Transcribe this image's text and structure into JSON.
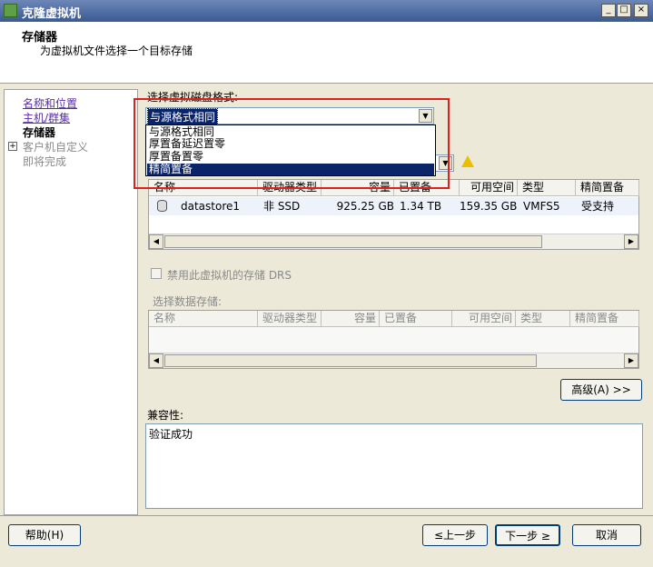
{
  "window": {
    "title": "克隆虚拟机",
    "min": "_",
    "max": "□",
    "close": "×"
  },
  "header": {
    "title": "存储器",
    "subtitle": "为虚拟机文件选择一个目标存储"
  },
  "nav": {
    "items": [
      {
        "label": "名称和位置"
      },
      {
        "label": "主机/群集"
      },
      {
        "label": "存储器"
      },
      {
        "label": "客户机自定义"
      },
      {
        "label": "即将完成"
      }
    ],
    "expander": "+"
  },
  "disk_format": {
    "label": "选择虚拟磁盘格式:",
    "selected": "与源格式相同",
    "options": [
      "与源格式相同",
      "厚置备延迟置零",
      "厚置备置零",
      "精简置备"
    ],
    "highlighted_index": 3
  },
  "storage_table": {
    "columns": [
      "名称",
      "驱动器类型",
      "容量",
      "已置备",
      "可用空间",
      "类型",
      "精简置备"
    ],
    "rows": [
      {
        "name": "datastore1",
        "drive": "非 SSD",
        "capacity": "925.25 GB",
        "provisioned": "1.34 TB",
        "free": "159.35 GB",
        "type": "VMFS5",
        "thin": "受支持"
      }
    ]
  },
  "drs": {
    "label": "禁用此虚拟机的存储 DRS"
  },
  "select_datastore": {
    "label": "选择数据存储:",
    "columns": [
      "名称",
      "驱动器类型",
      "容量",
      "已置备",
      "可用空间",
      "类型",
      "精简置备"
    ]
  },
  "advanced_button": "高级(A) >>",
  "compat": {
    "label": "兼容性:",
    "text": "验证成功"
  },
  "footer": {
    "help": "帮助(H)",
    "back": "≤上一步",
    "next": "下一步 ≥",
    "cancel": "取消"
  },
  "colors": {
    "highlight": "#0a246a",
    "annotation": "#e0201c",
    "link": "#5a2ea8"
  }
}
